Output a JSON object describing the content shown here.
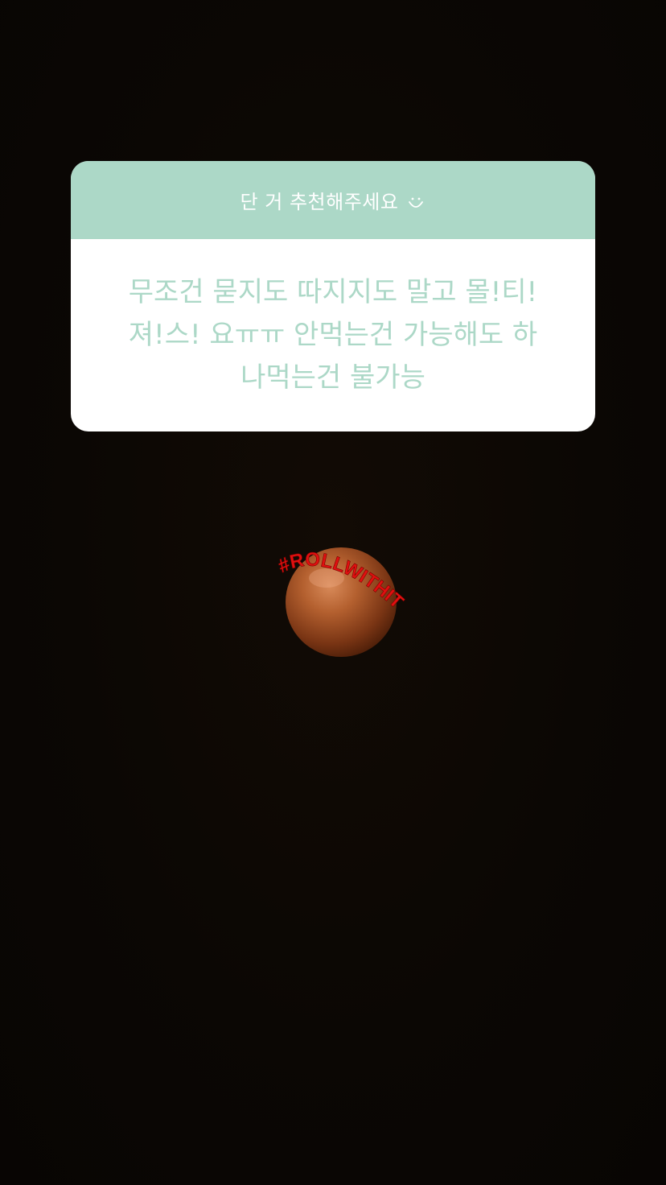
{
  "question_sticker": {
    "prompt": "단 거 추천해주세요",
    "prompt_icon": "smile-icon",
    "answer": "무조건 묻지도 따지지도 말고 몰!티!\n져!스! 요ㅠㅠ  안먹는건 가능해도 하\n나먹는건 불가능",
    "header_color": "#acd8c7",
    "answer_color": "#acd8c7"
  },
  "gif_sticker": {
    "text": "#ROLLWITHIT",
    "icon": "chocolate-ball-icon",
    "text_color": "#e01010"
  }
}
